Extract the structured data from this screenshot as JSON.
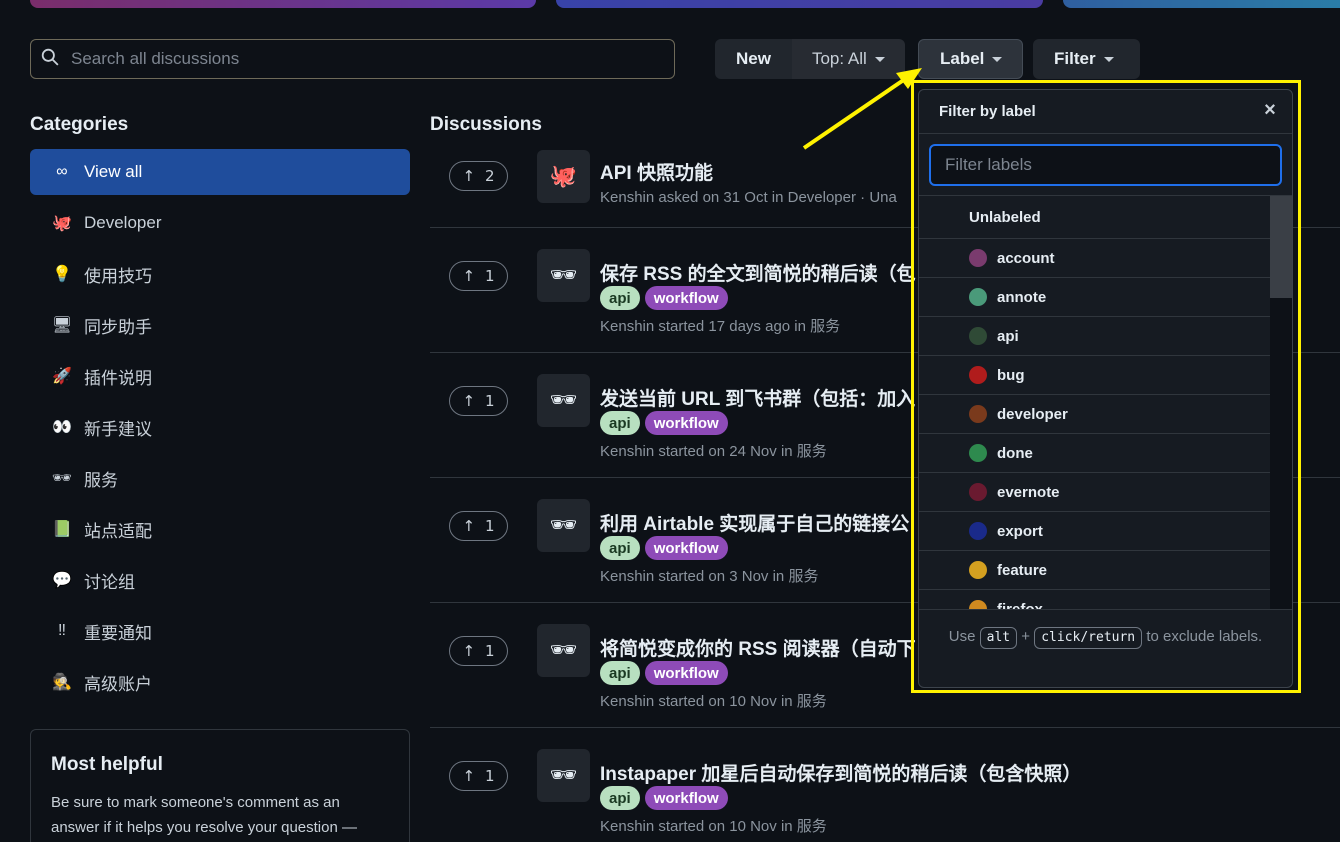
{
  "search": {
    "placeholder": "Search all discussions"
  },
  "toolbar": {
    "new_label": "New",
    "top_label": "Top: All",
    "label_label": "Label",
    "filter_label": "Filter"
  },
  "sidebar": {
    "title": "Categories",
    "items": [
      {
        "label": "View all",
        "icon": "infinity-icon",
        "glyph": "∞"
      },
      {
        "label": "Developer",
        "icon": "octocat-icon",
        "glyph": "🐙"
      },
      {
        "label": "使用技巧",
        "icon": "bulb-icon",
        "glyph": "💡"
      },
      {
        "label": "同步助手",
        "icon": "monitor-icon",
        "glyph": "🖥"
      },
      {
        "label": "插件说明",
        "icon": "rocket-icon",
        "glyph": "🚀"
      },
      {
        "label": "新手建议",
        "icon": "eyes-icon",
        "glyph": "👀"
      },
      {
        "label": "服务",
        "icon": "glasses-icon",
        "glyph": "🕶"
      },
      {
        "label": "站点适配",
        "icon": "book-icon",
        "glyph": "📗"
      },
      {
        "label": "讨论组",
        "icon": "speech-icon",
        "glyph": "💬"
      },
      {
        "label": "重要通知",
        "icon": "exclamation-icon",
        "glyph": "‼"
      },
      {
        "label": "高级账户",
        "icon": "spy-icon",
        "glyph": "🕵"
      }
    ],
    "helpful_title": "Most helpful",
    "helpful_text": "Be sure to mark someone's comment as an answer if it helps you resolve your question —"
  },
  "discussions": {
    "title": "Discussions",
    "items": [
      {
        "votes": "2",
        "title": "API 快照功能",
        "meta": "Kenshin asked on 31 Oct in Developer · Una",
        "tags": []
      },
      {
        "votes": "1",
        "title": "保存 RSS 的全文到简悦的稍后读（包",
        "meta": "Kenshin started 17 days ago in 服务",
        "tags": [
          "api",
          "workflow"
        ]
      },
      {
        "votes": "1",
        "title": "发送当前 URL 到飞书群（包括：加入",
        "meta": "Kenshin started on 24 Nov in 服务",
        "tags": [
          "api",
          "workflow"
        ]
      },
      {
        "votes": "1",
        "title": "利用 Airtable 实现属于自己的链接公",
        "meta": "Kenshin started on 3 Nov in 服务",
        "tags": [
          "api",
          "workflow"
        ]
      },
      {
        "votes": "1",
        "title": "将简悦变成你的 RSS 阅读器（自动下",
        "meta": "Kenshin started on 10 Nov in 服务",
        "tags": [
          "api",
          "workflow"
        ]
      },
      {
        "votes": "1",
        "title": "Instapaper 加星后自动保存到简悦的稍后读（包含快照）",
        "meta": "Kenshin started on 10 Nov in 服务",
        "tags": [
          "api",
          "workflow"
        ]
      }
    ]
  },
  "popup": {
    "title": "Filter by label",
    "filter_placeholder": "Filter labels",
    "unlabeled": "Unlabeled",
    "labels": [
      {
        "name": "account",
        "color": "#7a3b6e"
      },
      {
        "name": "annote",
        "color": "#4a9a7a"
      },
      {
        "name": "api",
        "color": "#2f4a36"
      },
      {
        "name": "bug",
        "color": "#b01c1c"
      },
      {
        "name": "developer",
        "color": "#7a3a1c"
      },
      {
        "name": "done",
        "color": "#2e8a4e"
      },
      {
        "name": "evernote",
        "color": "#6a1a30"
      },
      {
        "name": "export",
        "color": "#1a2a8a"
      },
      {
        "name": "feature",
        "color": "#d4a020"
      },
      {
        "name": "firefox",
        "color": "#d08a20"
      }
    ],
    "footer_use": "Use",
    "footer_key1": "alt",
    "footer_plus": "+",
    "footer_key2": "click/return",
    "footer_rest": "to exclude labels."
  }
}
